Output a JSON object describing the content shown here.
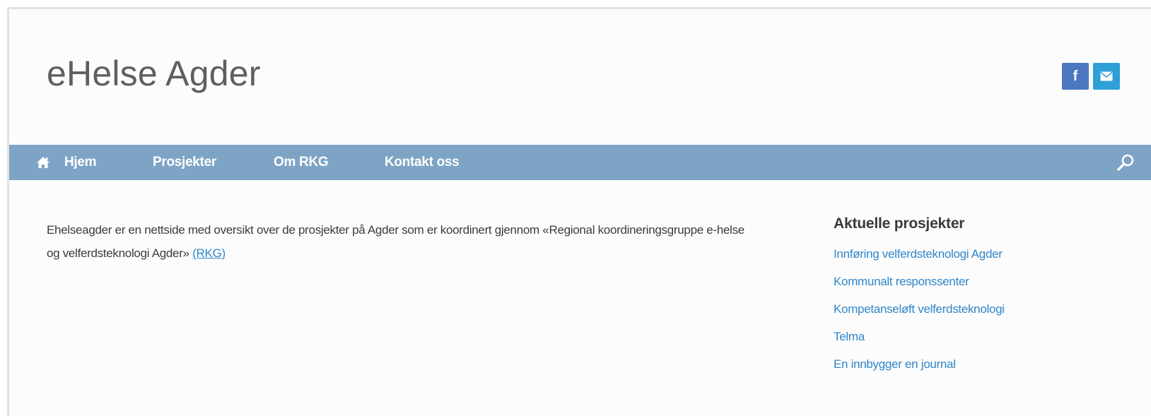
{
  "site": {
    "title": "eHelse Agder"
  },
  "social": {
    "facebook_icon": "facebook-icon",
    "email_icon": "email-icon",
    "facebook_glyph": "f"
  },
  "nav": {
    "home_icon": "home-icon",
    "items": [
      {
        "label": "Hjem"
      },
      {
        "label": "Prosjekter"
      },
      {
        "label": "Om RKG"
      },
      {
        "label": "Kontakt oss"
      }
    ],
    "search_icon": "search-icon"
  },
  "main": {
    "intro_text": "Ehelseagder er en nettside med oversikt over de prosjekter på Agder som er koordinert gjennom «Regional koordineringsgruppe e-helse og velferdsteknologi Agder» ",
    "intro_link": "(RKG) "
  },
  "sidebar": {
    "title": "Aktuelle prosjekter",
    "links": [
      {
        "label": "Innføring velferdsteknologi Agder"
      },
      {
        "label": "Kommunalt responssenter"
      },
      {
        "label": "Kompetanseløft velferdsteknologi"
      },
      {
        "label": "Telma"
      },
      {
        "label": "En innbygger en journal"
      }
    ]
  },
  "colors": {
    "nav_background": "#7ea4c5",
    "link": "#2f86c9",
    "facebook": "#4b76c0",
    "email": "#2f9fd8"
  }
}
